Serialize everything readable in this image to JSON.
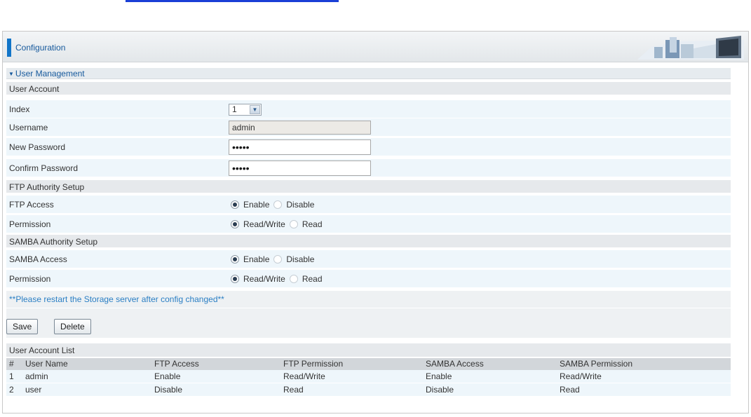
{
  "header": {
    "title": "Configuration"
  },
  "section": {
    "title": "User Management"
  },
  "user_account": {
    "section_label": "User Account",
    "index_label": "Index",
    "index_value": "1",
    "username_label": "Username",
    "username_value": "admin",
    "new_password_label": "New Password",
    "new_password_value": "•••••",
    "confirm_password_label": "Confirm Password",
    "confirm_password_value": "•••••"
  },
  "ftp": {
    "section_label": "FTP Authority Setup",
    "access_label": "FTP Access",
    "access_enable": "Enable",
    "access_disable": "Disable",
    "permission_label": "Permission",
    "perm_rw": "Read/Write",
    "perm_r": "Read"
  },
  "samba": {
    "section_label": "SAMBA Authority Setup",
    "access_label": "SAMBA Access",
    "access_enable": "Enable",
    "access_disable": "Disable",
    "permission_label": "Permission",
    "perm_rw": "Read/Write",
    "perm_r": "Read"
  },
  "note": "**Please restart the Storage server after config changed**",
  "buttons": {
    "save": "Save",
    "delete": "Delete"
  },
  "list": {
    "title": "User Account List",
    "columns": [
      "#",
      "User Name",
      "FTP Access",
      "FTP Permission",
      "SAMBA Access",
      "SAMBA Permission"
    ],
    "rows": [
      [
        "1",
        "admin",
        "Enable",
        "Read/Write",
        "Enable",
        "Read/Write"
      ],
      [
        "2",
        "user",
        "Disable",
        "Read",
        "Disable",
        "Read"
      ]
    ]
  },
  "colors": {
    "accent": "#1275c8",
    "title_text": "#16599c",
    "note_text": "#2b7fc4",
    "row_bg": "#eef6fb",
    "section_bg": "#e6e9ec"
  }
}
